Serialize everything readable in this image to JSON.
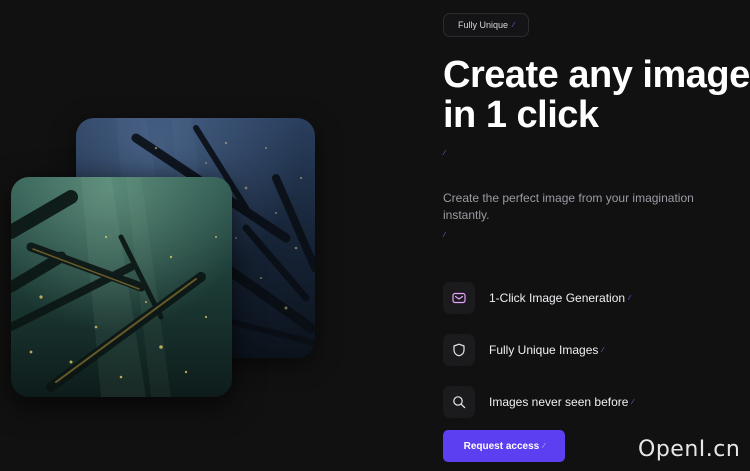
{
  "badge": {
    "label": "Fully Unique"
  },
  "hero": {
    "title_line1": "Create any image",
    "title_line2": "in 1 click",
    "subtitle": "Create the perfect image from your imagination instantly."
  },
  "features": [
    {
      "label": "1-Click Image Generation",
      "icon": "envelope-icon"
    },
    {
      "label": "Fully Unique Images",
      "icon": "shield-icon"
    },
    {
      "label": "Images never seen before",
      "icon": "search-icon"
    }
  ],
  "cta": {
    "label": "Request access"
  },
  "gallery": {
    "images": [
      {
        "name": "underwater-shipwreck-blue",
        "theme": "deep blue"
      },
      {
        "name": "underwater-shipwreck-green",
        "theme": "teal green"
      }
    ]
  },
  "watermark": {
    "text": "OpenI.cn"
  },
  "colors": {
    "background": "#111112",
    "accent": "#5b3ff0",
    "pencil_mark": "#7b6cff",
    "muted_text": "#9b9ba3"
  }
}
